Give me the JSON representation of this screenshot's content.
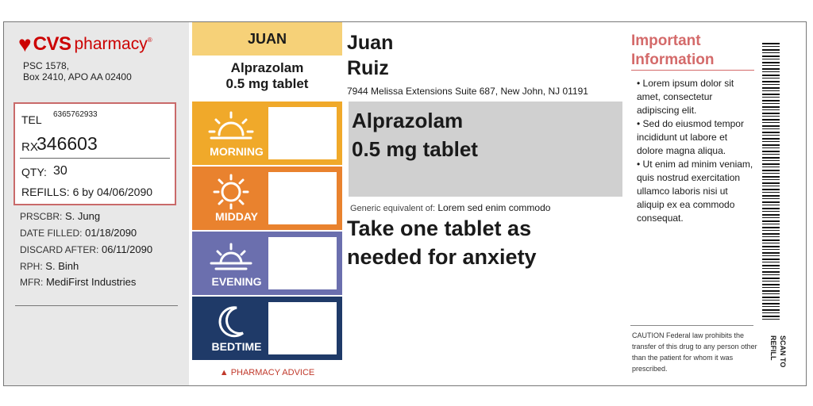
{
  "brand": {
    "cvs": "CVS",
    "pharmacy": "pharmacy",
    "heart": "♥",
    "mark": "®"
  },
  "store_address": [
    "PSC 1578,",
    "Box 2410, APO AA 02400"
  ],
  "rx": {
    "tel_label": "TEL",
    "tel": "6365762933",
    "rx_label": "RX",
    "rx_number": "346603",
    "qty_label": "QTY:",
    "qty": "30",
    "refills_label": "REFILLS:",
    "refills": "6 by 04/06/2090"
  },
  "details": [
    {
      "label": "PRSCBR:",
      "value": "S. Jung"
    },
    {
      "label": "DATE FILLED:",
      "value": "01/18/2090"
    },
    {
      "label": "DISCARD AFTER:",
      "value": "06/11/2090"
    },
    {
      "label": "RPH:",
      "value": "S. Binh"
    },
    {
      "label": "MFR:",
      "value": "MediFirst Industries"
    }
  ],
  "schedule": {
    "name_tag": "JUAN",
    "drug_line1": "Alprazolam",
    "drug_line2": "0.5 mg tablet",
    "slots": [
      {
        "label": "MORNING",
        "color": "#f0a92a",
        "icon": "sunrise-icon"
      },
      {
        "label": "MIDDAY",
        "color": "#e9822e",
        "icon": "sun-icon"
      },
      {
        "label": "EVENING",
        "color": "#6b6fae",
        "icon": "sunset-icon"
      },
      {
        "label": "BEDTIME",
        "color": "#1f3a68",
        "icon": "moon-icon"
      }
    ],
    "advice": "▲ PHARMACY ADVICE"
  },
  "patient": {
    "first_name": "Juan",
    "last_name": "Ruiz",
    "address": "7944 Melissa Extensions Suite 687, New John, NJ 01191"
  },
  "medication": {
    "line1": "Alprazolam",
    "line2": "0.5 mg tablet",
    "generic_label": "Generic equivalent of:",
    "generic_value": "Lorem sed enim commodo",
    "sig_line1": "Take one tablet as",
    "sig_line2": "needed for anxiety"
  },
  "important": {
    "title_line1": "Important",
    "title_line2": "Information",
    "bullets": [
      "• Lorem ipsum dolor sit amet, consectetur adipiscing elit.",
      "• Sed do eiusmod tempor incididunt ut labore et dolore magna aliqua.",
      "• Ut enim ad minim veniam, quis nostrud exercitation ullamco laboris nisi ut aliquip ex ea commodo consequat."
    ],
    "caution": "CAUTION Federal law prohibits the transfer of this drug to any person other than the patient for whom it was prescribed."
  },
  "scan": {
    "line1": "SCAN TO",
    "line2": "REFILL"
  },
  "colors": {
    "brand_red": "#cc0000",
    "name_tag": "#f6d178",
    "important_title": "#d46a6a"
  }
}
